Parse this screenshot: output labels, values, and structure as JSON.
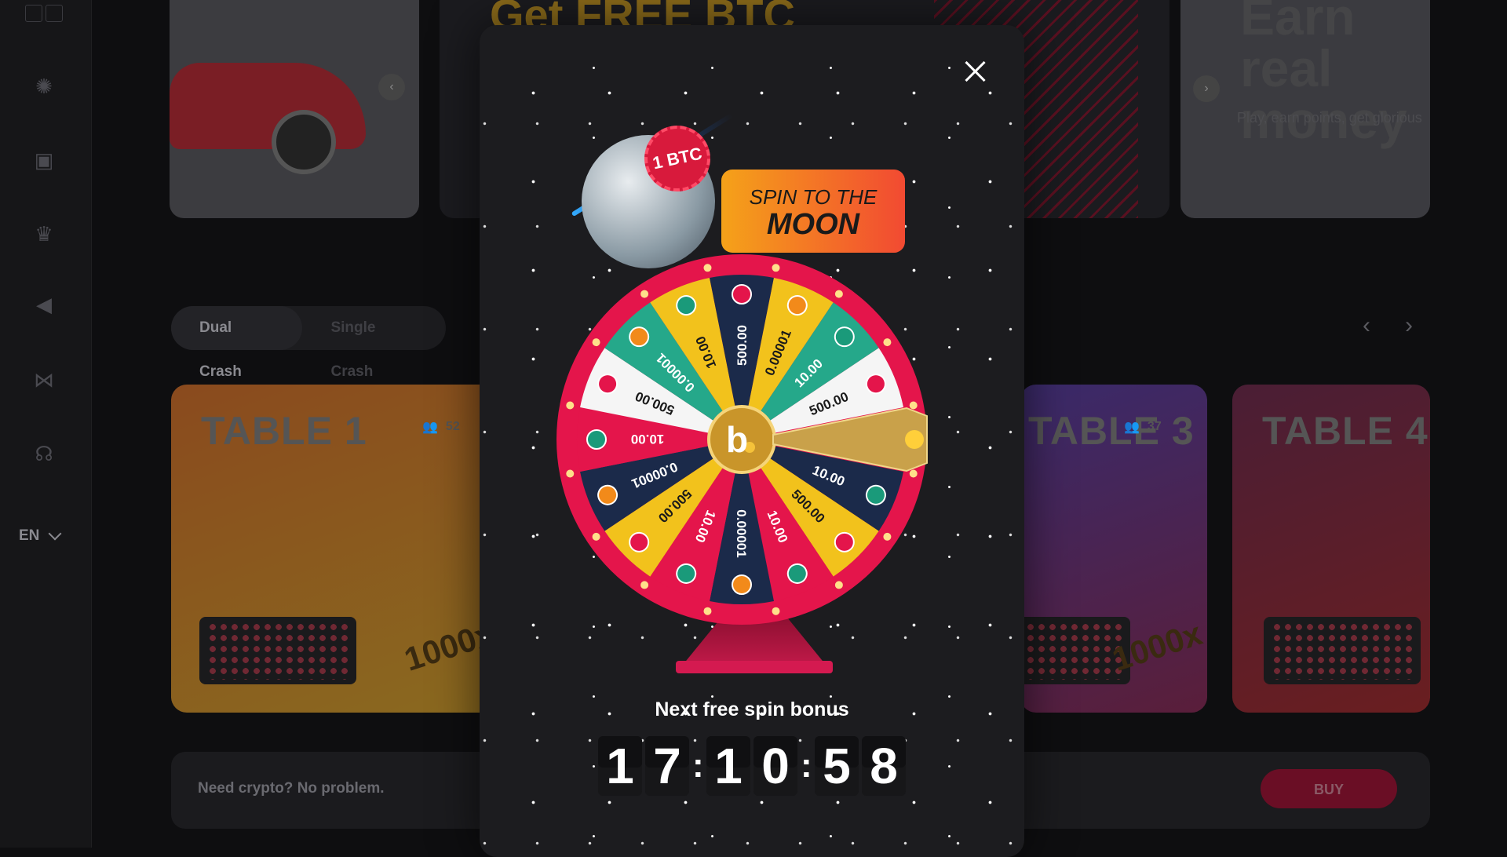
{
  "sidebar": {
    "icons": [
      "casino-chip-icon",
      "games-icon",
      "crown-icon",
      "megaphone-icon",
      "share-icon",
      "headset-icon"
    ],
    "language": "EN"
  },
  "banners": {
    "center_title": "Get FREE BTC",
    "right_title": "Earn real money",
    "right_subtitle": "Play, earn points, get glorious"
  },
  "modes": {
    "tabs": [
      {
        "label": "Dual Crash",
        "active": true
      },
      {
        "label": "Single Crash",
        "active": false
      }
    ]
  },
  "tables": [
    {
      "title": "TABLE 1",
      "players": "52",
      "multiplier": "1000x"
    },
    {
      "title": "TABLE 3",
      "players": "37",
      "multiplier": "1000x"
    },
    {
      "title": "TABLE 4",
      "players": "",
      "multiplier": ""
    }
  ],
  "crypto_bar": {
    "text": "Need crypto? No problem.",
    "buy_label": "BUY"
  },
  "modal": {
    "badge": "1 BTC",
    "banner_line1": "SPIN TO THE",
    "banner_line2": "MOON",
    "next_label": "Next free spin bonus",
    "timer": {
      "hours": [
        "1",
        "7"
      ],
      "minutes": [
        "1",
        "0"
      ],
      "seconds": [
        "5",
        "8"
      ]
    },
    "wheel_segments": [
      {
        "label": "0.00001",
        "coin": "bitcoin-icon",
        "color": "#e4154b"
      },
      {
        "label": "10.00",
        "coin": "tether-icon",
        "color": "#1b2a4a"
      },
      {
        "label": "500.00",
        "coin": "game-token-icon",
        "color": "#f2c21c"
      },
      {
        "label": "10.00",
        "coin": "tether-icon",
        "color": "#e4154b"
      },
      {
        "label": "0.00001",
        "coin": "bitcoin-icon",
        "color": "#1b2a4a"
      },
      {
        "label": "10.00",
        "coin": "tether-icon",
        "color": "#e4154b"
      },
      {
        "label": "500.00",
        "coin": "game-token-icon",
        "color": "#f2c21c"
      },
      {
        "label": "0.00001",
        "coin": "bitcoin-icon",
        "color": "#1b2a4a"
      },
      {
        "label": "10.00",
        "coin": "tether-icon",
        "color": "#e4154b"
      },
      {
        "label": "500.00",
        "coin": "game-token-icon",
        "color": "#f5f5f5"
      },
      {
        "label": "0.00001",
        "coin": "bitcoin-icon",
        "color": "#25a88a"
      },
      {
        "label": "10.00",
        "coin": "tether-icon",
        "color": "#f2c21c"
      },
      {
        "label": "500.00",
        "coin": "game-token-icon",
        "color": "#1b2a4a"
      },
      {
        "label": "0.00001",
        "coin": "bitcoin-icon",
        "color": "#f2c21c"
      },
      {
        "label": "10.00",
        "coin": "tether-icon",
        "color": "#25a88a"
      },
      {
        "label": "500.00",
        "coin": "game-token-icon",
        "color": "#f5f5f5"
      }
    ],
    "colors": {
      "rim": "#e4154b",
      "pointer": "#c9a14a",
      "hub": "#c9952a"
    }
  }
}
